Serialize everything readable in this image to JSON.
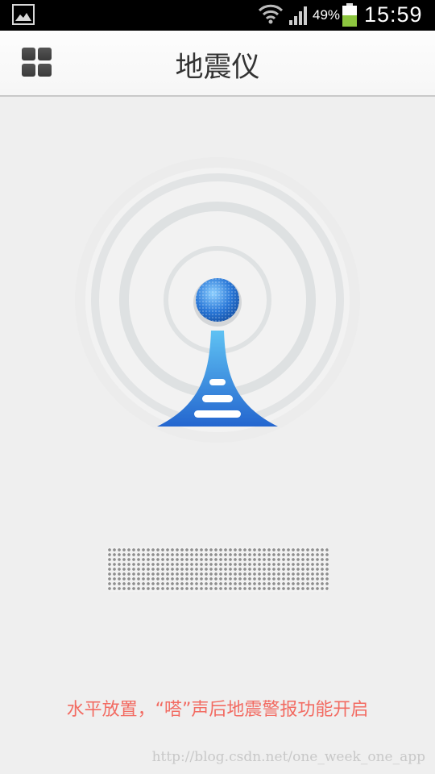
{
  "status_bar": {
    "battery_percent": "49%",
    "time": "15:59",
    "icons": [
      "gallery-icon",
      "wifi-icon",
      "signal-icon",
      "battery-icon"
    ]
  },
  "header": {
    "title": "地震仪",
    "menu_icon": "grid-menu-icon"
  },
  "main": {
    "hint": "水平放置，“嗒”声后地震警报功能开启",
    "graphic": "seismometer-antenna-icon"
  },
  "watermark": "http://blog.csdn.net/one_week_one_app",
  "colors": {
    "hint": "#f26b62",
    "antenna_blue": "#2a78d8",
    "background": "#efefef"
  }
}
